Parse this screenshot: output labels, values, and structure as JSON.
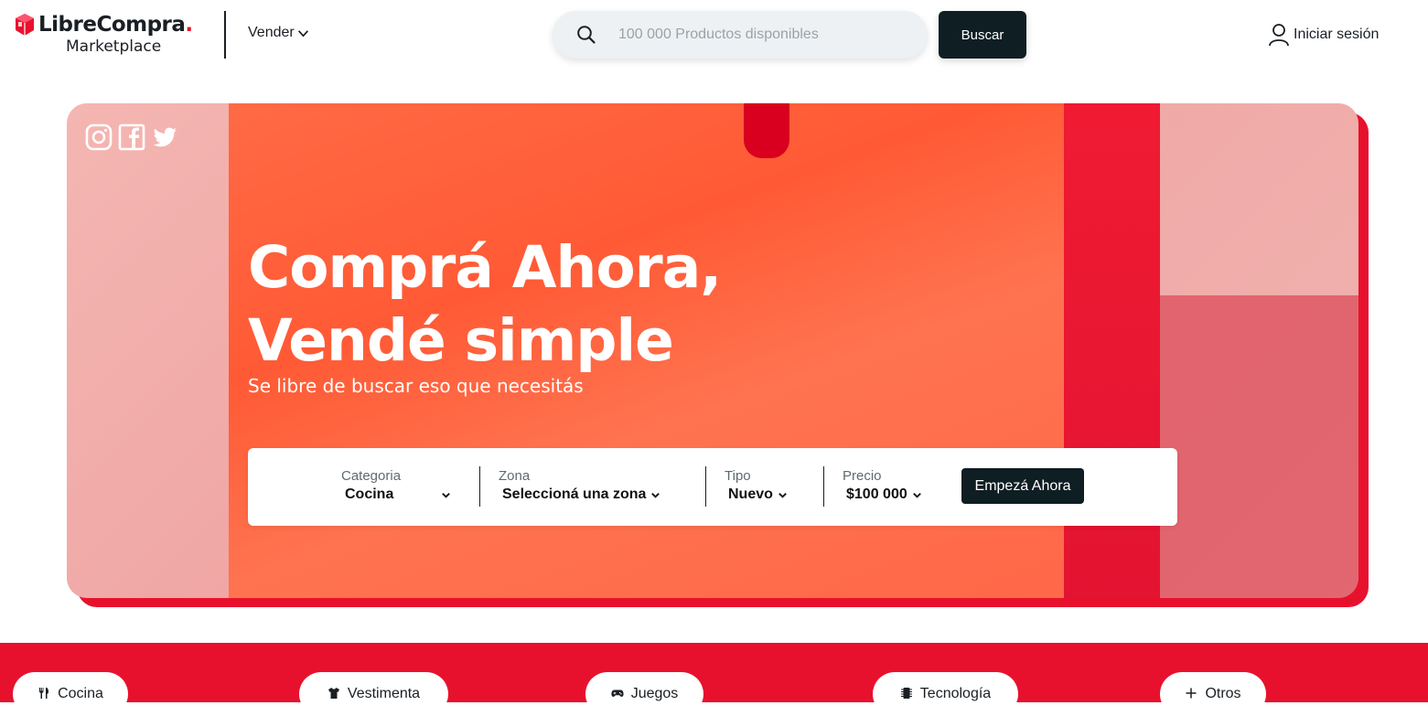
{
  "header": {
    "logo_title": "LibreCompra",
    "logo_dot": ".",
    "logo_subtitle": "Marketplace",
    "vender_label": "Vender",
    "search_placeholder": "100 000 Productos disponibles",
    "search_button": "Buscar",
    "login_label": "Iniciar sesión"
  },
  "hero": {
    "title_line1": "Comprá Ahora,",
    "title_line2": "Vendé simple",
    "subtitle": "Se libre de buscar eso que necesitás",
    "social_icons": [
      "instagram-icon",
      "facebook-icon",
      "twitter-icon"
    ]
  },
  "filters": {
    "categoria": {
      "label": "Categoria",
      "value": "Cocina"
    },
    "zona": {
      "label": "Zona",
      "value": "Seleccioná una zona"
    },
    "tipo": {
      "label": "Tipo",
      "value": "Nuevo"
    },
    "precio": {
      "label": "Precio",
      "value": "$100 000"
    },
    "cta": "Empezá Ahora"
  },
  "categories": [
    {
      "label": "Cocina",
      "icon": "utensils-icon"
    },
    {
      "label": "Vestimenta",
      "icon": "shirt-icon"
    },
    {
      "label": "Juegos",
      "icon": "gamepad-icon"
    },
    {
      "label": "Tecnología",
      "icon": "chip-icon"
    },
    {
      "label": "Otros",
      "icon": "plus-icon"
    }
  ],
  "colors": {
    "brand_red": "#e8112d",
    "dark": "#0e1e23",
    "hero_orange": "#ff5a35"
  }
}
